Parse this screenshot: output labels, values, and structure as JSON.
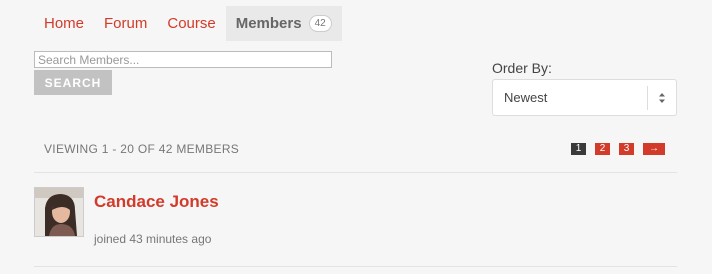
{
  "nav": {
    "tabs": [
      {
        "label": "Home"
      },
      {
        "label": "Forum"
      },
      {
        "label": "Course"
      },
      {
        "label": "Members",
        "count": "42"
      }
    ]
  },
  "search": {
    "placeholder": "Search Members...",
    "value": "",
    "button_label": "SEARCH"
  },
  "order": {
    "label": "Order By:",
    "selected": "Newest",
    "icon": "updown-arrows-icon"
  },
  "listing": {
    "viewing_text": "VIEWING 1 - 20 OF 42 MEMBERS",
    "pages": [
      "1",
      "2",
      "3"
    ],
    "current_page": "1",
    "next_label": "→"
  },
  "members": [
    {
      "name": "Candace Jones",
      "joined": "joined 43 minutes ago"
    }
  ],
  "colors": {
    "accent": "#d23b2a",
    "background": "#f6f6f6",
    "active_tab": "#e9e9e9",
    "current_page": "#3a3a3a",
    "search_button": "#c2c2c2"
  }
}
